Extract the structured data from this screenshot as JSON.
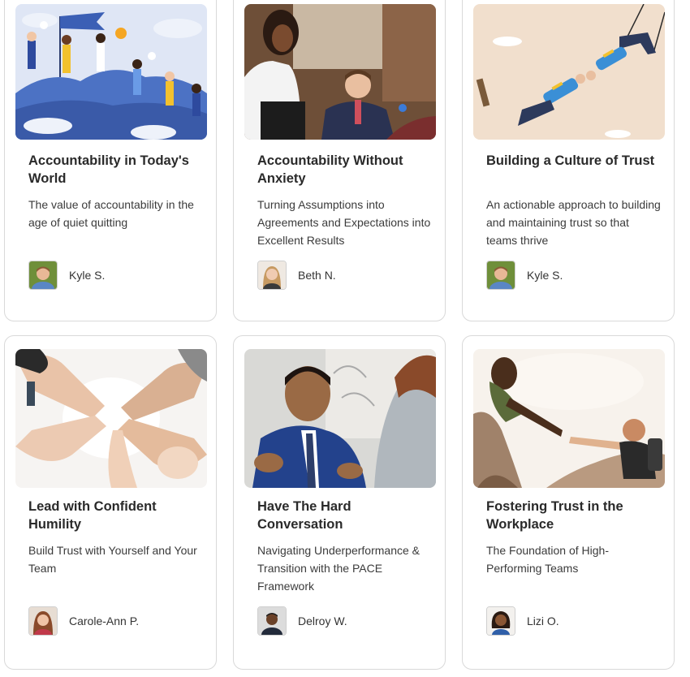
{
  "courses": [
    {
      "title": "Accountability in Today's World",
      "subtitle": "The value of accountability in the age of quiet quitting",
      "author": "Kyle S.",
      "image_icon": "team-climbing-illustration-icon",
      "avatar_icon": "kyle-avatar-icon"
    },
    {
      "title": "Accountability Without Anxiety",
      "subtitle": "Turning Assumptions into Agreements and Expectations into Excellent Results",
      "author": "Beth N.",
      "image_icon": "business-meeting-photo-icon",
      "avatar_icon": "beth-avatar-icon"
    },
    {
      "title": "Building a Culture of Trust",
      "subtitle": "An actionable approach to building and maintaining trust so that teams thrive",
      "author": "Kyle S.",
      "image_icon": "trapeze-trust-illustration-icon",
      "avatar_icon": "kyle-avatar-icon"
    },
    {
      "title": "Lead with Confident Humility",
      "subtitle": "Build Trust with Yourself and Your Team",
      "author": "Carole-Ann P.",
      "image_icon": "joined-hands-circle-photo-icon",
      "avatar_icon": "carole-ann-avatar-icon"
    },
    {
      "title": "Have The Hard Conversation",
      "subtitle": "Navigating Underperformance & Transition with the PACE Framework",
      "author": "Delroy W.",
      "image_icon": "businessman-conversation-photo-icon",
      "avatar_icon": "delroy-avatar-icon"
    },
    {
      "title": "Fostering Trust in the Workplace",
      "subtitle": "The Foundation of High-Performing Teams",
      "author": "Lizi O.",
      "image_icon": "helping-hand-climb-photo-icon",
      "avatar_icon": "lizi-avatar-icon"
    }
  ],
  "colors": {
    "card_border": "#d9d9d9",
    "title_text": "#2a2a2a",
    "body_text": "#3b3b3b"
  }
}
